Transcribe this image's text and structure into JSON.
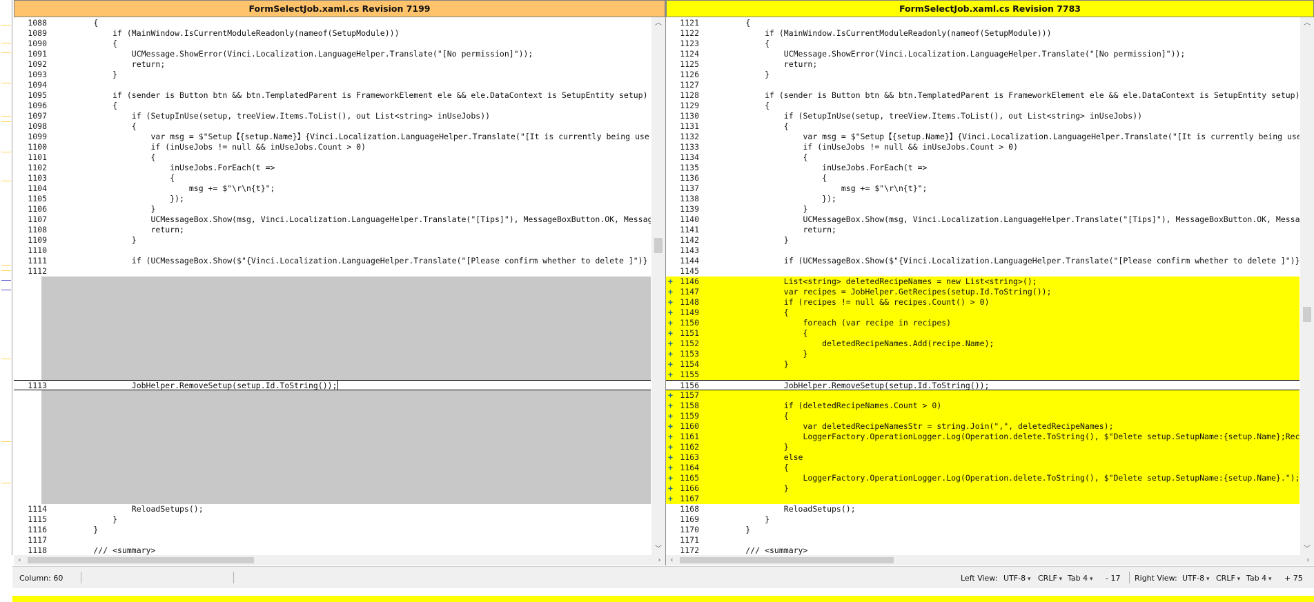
{
  "left": {
    "title": "FormSelectJob.xaml.cs Revision 7199",
    "lines": [
      {
        "n": "1088",
        "t": "        {"
      },
      {
        "n": "1089",
        "t": "            if (MainWindow.IsCurrentModuleReadonly(nameof(SetupModule)))"
      },
      {
        "n": "1090",
        "t": "            {"
      },
      {
        "n": "1091",
        "t": "                UCMessage.ShowError(Vinci.Localization.LanguageHelper.Translate(\"[No permission]\"));"
      },
      {
        "n": "1092",
        "t": "                return;"
      },
      {
        "n": "1093",
        "t": "            }"
      },
      {
        "n": "1094",
        "t": ""
      },
      {
        "n": "1095",
        "t": "            if (sender is Button btn && btn.TemplatedParent is FrameworkElement ele && ele.DataContext is SetupEntity setup)"
      },
      {
        "n": "1096",
        "t": "            {"
      },
      {
        "n": "1097",
        "t": "                if (SetupInUse(setup, treeView.Items.ToList(), out List<string> inUseJobs))"
      },
      {
        "n": "1098",
        "t": "                {"
      },
      {
        "n": "1099",
        "t": "                    var msg = $\"Setup【{setup.Name}】{Vinci.Localization.LanguageHelper.Translate(\"[It is currently being use"
      },
      {
        "n": "1100",
        "t": "                    if (inUseJobs != null && inUseJobs.Count > 0)"
      },
      {
        "n": "1101",
        "t": "                    {"
      },
      {
        "n": "1102",
        "t": "                        inUseJobs.ForEach(t =>"
      },
      {
        "n": "1103",
        "t": "                        {"
      },
      {
        "n": "1104",
        "t": "                            msg += $\"\\r\\n{t}\";"
      },
      {
        "n": "1105",
        "t": "                        });"
      },
      {
        "n": "1106",
        "t": "                    }"
      },
      {
        "n": "1107",
        "t": "                    UCMessageBox.Show(msg, Vinci.Localization.LanguageHelper.Translate(\"[Tips]\"), MessageBoxButton.OK, Messag"
      },
      {
        "n": "1108",
        "t": "                    return;"
      },
      {
        "n": "1109",
        "t": "                }"
      },
      {
        "n": "1110",
        "t": ""
      },
      {
        "n": "1111",
        "t": "                if (UCMessageBox.Show($\"{Vinci.Localization.LanguageHelper.Translate(\"[Please confirm whether to delete ]\")}"
      },
      {
        "n": "1112",
        "t": ""
      },
      {
        "n": "1113",
        "t": "                JobHelper.RemoveSetup(setup.Id.ToString());"
      },
      {
        "n": "1114",
        "t": "                ReloadSetups();"
      },
      {
        "n": "1115",
        "t": "            }"
      },
      {
        "n": "1116",
        "t": "        }"
      },
      {
        "n": "1117",
        "t": ""
      },
      {
        "n": "1118",
        "t": "        /// <summary>"
      }
    ]
  },
  "right": {
    "title": "FormSelectJob.xaml.cs Revision 7783",
    "lines": [
      {
        "n": "1121",
        "t": "        {",
        "a": false
      },
      {
        "n": "1122",
        "t": "            if (MainWindow.IsCurrentModuleReadonly(nameof(SetupModule)))",
        "a": false
      },
      {
        "n": "1123",
        "t": "            {",
        "a": false
      },
      {
        "n": "1124",
        "t": "                UCMessage.ShowError(Vinci.Localization.LanguageHelper.Translate(\"[No permission]\"));",
        "a": false
      },
      {
        "n": "1125",
        "t": "                return;",
        "a": false
      },
      {
        "n": "1126",
        "t": "            }",
        "a": false
      },
      {
        "n": "1127",
        "t": "",
        "a": false
      },
      {
        "n": "1128",
        "t": "            if (sender is Button btn && btn.TemplatedParent is FrameworkElement ele && ele.DataContext is SetupEntity setup)",
        "a": false
      },
      {
        "n": "1129",
        "t": "            {",
        "a": false
      },
      {
        "n": "1130",
        "t": "                if (SetupInUse(setup, treeView.Items.ToList(), out List<string> inUseJobs))",
        "a": false
      },
      {
        "n": "1131",
        "t": "                {",
        "a": false
      },
      {
        "n": "1132",
        "t": "                    var msg = $\"Setup【{setup.Name}】{Vinci.Localization.LanguageHelper.Translate(\"[It is currently being use",
        "a": false
      },
      {
        "n": "1133",
        "t": "                    if (inUseJobs != null && inUseJobs.Count > 0)",
        "a": false
      },
      {
        "n": "1134",
        "t": "                    {",
        "a": false
      },
      {
        "n": "1135",
        "t": "                        inUseJobs.ForEach(t =>",
        "a": false
      },
      {
        "n": "1136",
        "t": "                        {",
        "a": false
      },
      {
        "n": "1137",
        "t": "                            msg += $\"\\r\\n{t}\";",
        "a": false
      },
      {
        "n": "1138",
        "t": "                        });",
        "a": false
      },
      {
        "n": "1139",
        "t": "                    }",
        "a": false
      },
      {
        "n": "1140",
        "t": "                    UCMessageBox.Show(msg, Vinci.Localization.LanguageHelper.Translate(\"[Tips]\"), MessageBoxButton.OK, Messag",
        "a": false
      },
      {
        "n": "1141",
        "t": "                    return;",
        "a": false
      },
      {
        "n": "1142",
        "t": "                }",
        "a": false
      },
      {
        "n": "1143",
        "t": "",
        "a": false
      },
      {
        "n": "1144",
        "t": "                if (UCMessageBox.Show($\"{Vinci.Localization.LanguageHelper.Translate(\"[Please confirm whether to delete ]\")}",
        "a": false
      },
      {
        "n": "1145",
        "t": "",
        "a": false
      },
      {
        "n": "1146",
        "t": "                List<string> deletedRecipeNames = new List<string>();",
        "a": true
      },
      {
        "n": "1147",
        "t": "                var recipes = JobHelper.GetRecipes(setup.Id.ToString());",
        "a": true
      },
      {
        "n": "1148",
        "t": "                if (recipes != null && recipes.Count() > 0)",
        "a": true
      },
      {
        "n": "1149",
        "t": "                {",
        "a": true
      },
      {
        "n": "1150",
        "t": "                    foreach (var recipe in recipes)",
        "a": true
      },
      {
        "n": "1151",
        "t": "                    {",
        "a": true
      },
      {
        "n": "1152",
        "t": "                        deletedRecipeNames.Add(recipe.Name);",
        "a": true
      },
      {
        "n": "1153",
        "t": "                    }",
        "a": true
      },
      {
        "n": "1154",
        "t": "                }",
        "a": true
      },
      {
        "n": "1155",
        "t": "",
        "a": true
      },
      {
        "n": "1156",
        "t": "                JobHelper.RemoveSetup(setup.Id.ToString());",
        "a": false
      },
      {
        "n": "1157",
        "t": "",
        "a": true
      },
      {
        "n": "1158",
        "t": "                if (deletedRecipeNames.Count > 0)",
        "a": true
      },
      {
        "n": "1159",
        "t": "                {",
        "a": true
      },
      {
        "n": "1160",
        "t": "                    var deletedRecipeNamesStr = string.Join(\",\", deletedRecipeNames);",
        "a": true
      },
      {
        "n": "1161",
        "t": "                    LoggerFactory.OperationLogger.Log(Operation.delete.ToString(), $\"Delete setup.SetupName:{setup.Name};Rec",
        "a": true
      },
      {
        "n": "1162",
        "t": "                }",
        "a": true
      },
      {
        "n": "1163",
        "t": "                else",
        "a": true
      },
      {
        "n": "1164",
        "t": "                {",
        "a": true
      },
      {
        "n": "1165",
        "t": "                    LoggerFactory.OperationLogger.Log(Operation.delete.ToString(), $\"Delete setup.SetupName:{setup.Name}.\");",
        "a": true
      },
      {
        "n": "1166",
        "t": "                }",
        "a": true
      },
      {
        "n": "1167",
        "t": "",
        "a": true
      },
      {
        "n": "1168",
        "t": "                ReloadSetups();",
        "a": false
      },
      {
        "n": "1169",
        "t": "            }",
        "a": false
      },
      {
        "n": "1170",
        "t": "        }",
        "a": false
      },
      {
        "n": "1171",
        "t": "",
        "a": false
      },
      {
        "n": "1172",
        "t": "        /// <summary>",
        "a": false
      }
    ]
  },
  "added_marker": "+",
  "status": {
    "column": "Column: 60",
    "left_view_label": "Left View:",
    "left_encoding": "UTF-8",
    "left_eol": "CRLF",
    "left_tab": "Tab 4",
    "left_diff": "- 17",
    "right_view_label": "Right View:",
    "right_encoding": "UTF-8",
    "right_eol": "CRLF",
    "right_tab": "Tab 4",
    "right_diff": "+ 75"
  },
  "icons": {
    "scroll_up": "scroll-up-arrow-icon",
    "scroll_down": "scroll-down-arrow-icon",
    "scroll_left": "scroll-left-arrow-icon",
    "scroll_right": "scroll-right-arrow-icon"
  },
  "colors": {
    "left_header": "#ffc36b",
    "right_header": "#ffff00",
    "added": "#ffff00",
    "gap": "#c8c8c8"
  }
}
